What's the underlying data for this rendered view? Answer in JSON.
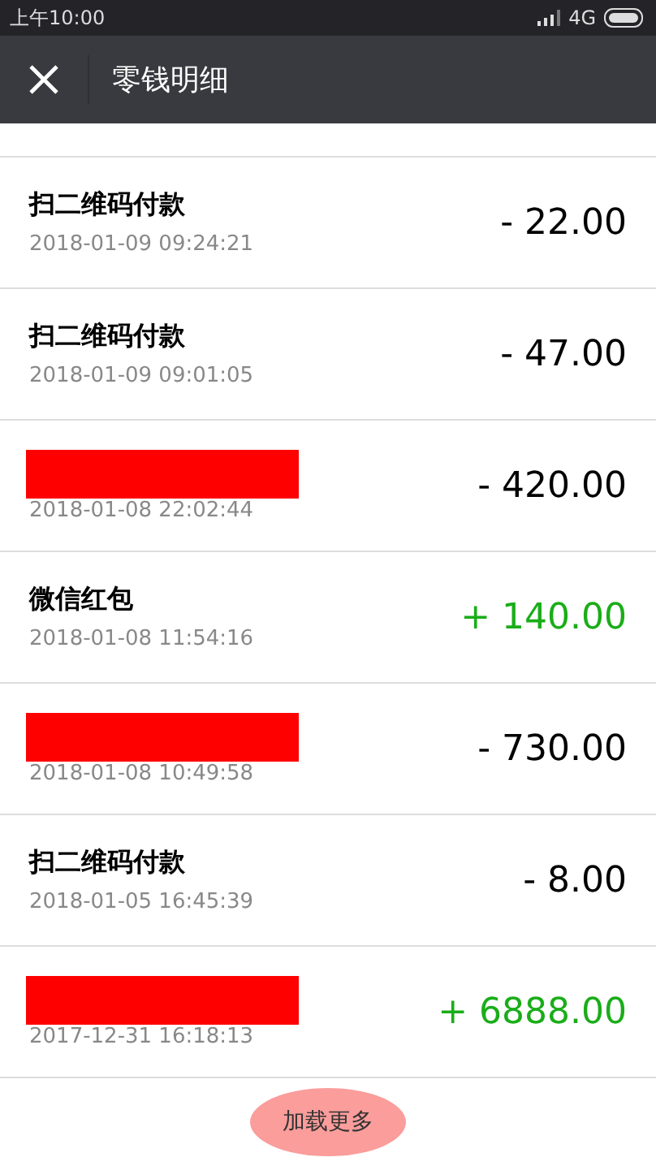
{
  "status_bar": {
    "time": "上午10:00",
    "network": "4G"
  },
  "header": {
    "title": "零钱明细"
  },
  "transactions": [
    {
      "kind": "titled",
      "title": "扫二维码付款",
      "time": "2018-01-09 09:24:21",
      "amount": "- 22.00",
      "income": false
    },
    {
      "kind": "titled",
      "title": "扫二维码付款",
      "time": "2018-01-09 09:01:05",
      "amount": "- 47.00",
      "income": false
    },
    {
      "kind": "redacted",
      "time": "2018-01-08 22:02:44",
      "amount": "- 420.00",
      "income": false
    },
    {
      "kind": "titled",
      "title": "微信红包",
      "time": "2018-01-08 11:54:16",
      "amount": "+ 140.00",
      "income": true
    },
    {
      "kind": "redacted",
      "time": "2018-01-08 10:49:58",
      "amount": "- 730.00",
      "income": false
    },
    {
      "kind": "titled",
      "title": "扫二维码付款",
      "time": "2018-01-05 16:45:39",
      "amount": "- 8.00",
      "income": false
    },
    {
      "kind": "redacted",
      "time": "2017-12-31 16:18:13",
      "amount": "+ 6888.00",
      "income": true
    }
  ],
  "load_more": "加载更多"
}
